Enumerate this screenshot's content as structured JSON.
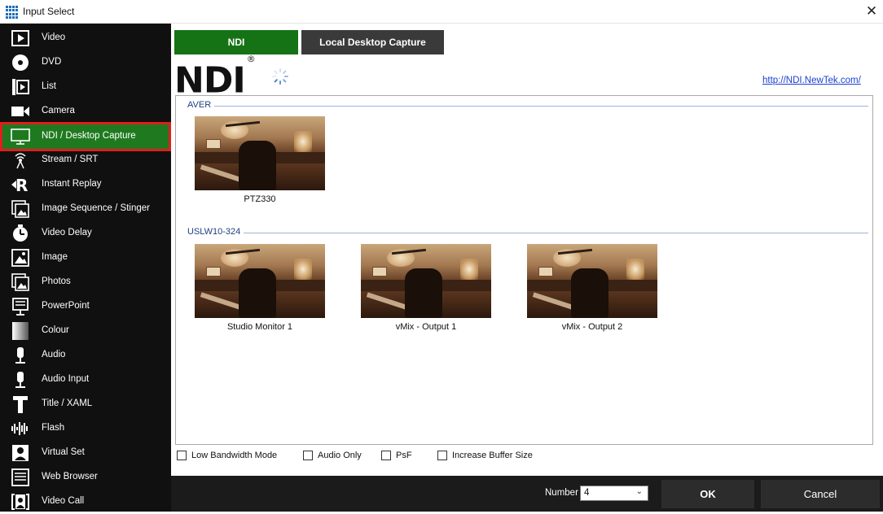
{
  "window": {
    "title": "Input Select",
    "close_glyph": "✕"
  },
  "sidebar": {
    "items": [
      {
        "label": "Video",
        "icon": "video-film-icon"
      },
      {
        "label": "DVD",
        "icon": "disc-icon"
      },
      {
        "label": "List",
        "icon": "list-icon"
      },
      {
        "label": "Camera",
        "icon": "camera-icon"
      },
      {
        "label": "NDI / Desktop Capture",
        "icon": "monitor-icon",
        "selected": true
      },
      {
        "label": "Stream / SRT",
        "icon": "broadcast-icon"
      },
      {
        "label": "Instant Replay",
        "icon": "replay-icon"
      },
      {
        "label": "Image Sequence / Stinger",
        "icon": "image-sequence-icon"
      },
      {
        "label": "Video Delay",
        "icon": "clock-icon"
      },
      {
        "label": "Image",
        "icon": "image-icon"
      },
      {
        "label": "Photos",
        "icon": "photos-icon"
      },
      {
        "label": "PowerPoint",
        "icon": "presentation-icon"
      },
      {
        "label": "Colour",
        "icon": "colour-icon"
      },
      {
        "label": "Audio",
        "icon": "microphone-icon"
      },
      {
        "label": "Audio Input",
        "icon": "microphone-icon"
      },
      {
        "label": "Title / XAML",
        "icon": "title-icon"
      },
      {
        "label": "Flash",
        "icon": "waveform-icon"
      },
      {
        "label": "Virtual Set",
        "icon": "person-icon"
      },
      {
        "label": "Web Browser",
        "icon": "browser-icon"
      },
      {
        "label": "Video Call",
        "icon": "video-call-icon"
      }
    ]
  },
  "tabs": {
    "ndi": "NDI",
    "local_desktop": "Local Desktop Capture"
  },
  "ndi": {
    "logo": "NDI",
    "registered": "®",
    "link": "http://NDI.NewTek.com/"
  },
  "groups": [
    {
      "name": "AVER",
      "sources": [
        "PTZ330"
      ]
    },
    {
      "name": "USLW10-324",
      "sources": [
        "Studio Monitor 1",
        "vMix - Output 1",
        "vMix - Output 2"
      ]
    }
  ],
  "options": {
    "low_bandwidth": "Low Bandwidth Mode",
    "audio_only": "Audio Only",
    "psf": "PsF",
    "increase_buffer": "Increase Buffer Size"
  },
  "footer": {
    "number_label": "Number",
    "number_value": "4",
    "ok": "OK",
    "cancel": "Cancel"
  },
  "colors": {
    "accent_green": "#157315",
    "selection_outline": "#e11d1d",
    "sidebar_bg": "#101010"
  }
}
